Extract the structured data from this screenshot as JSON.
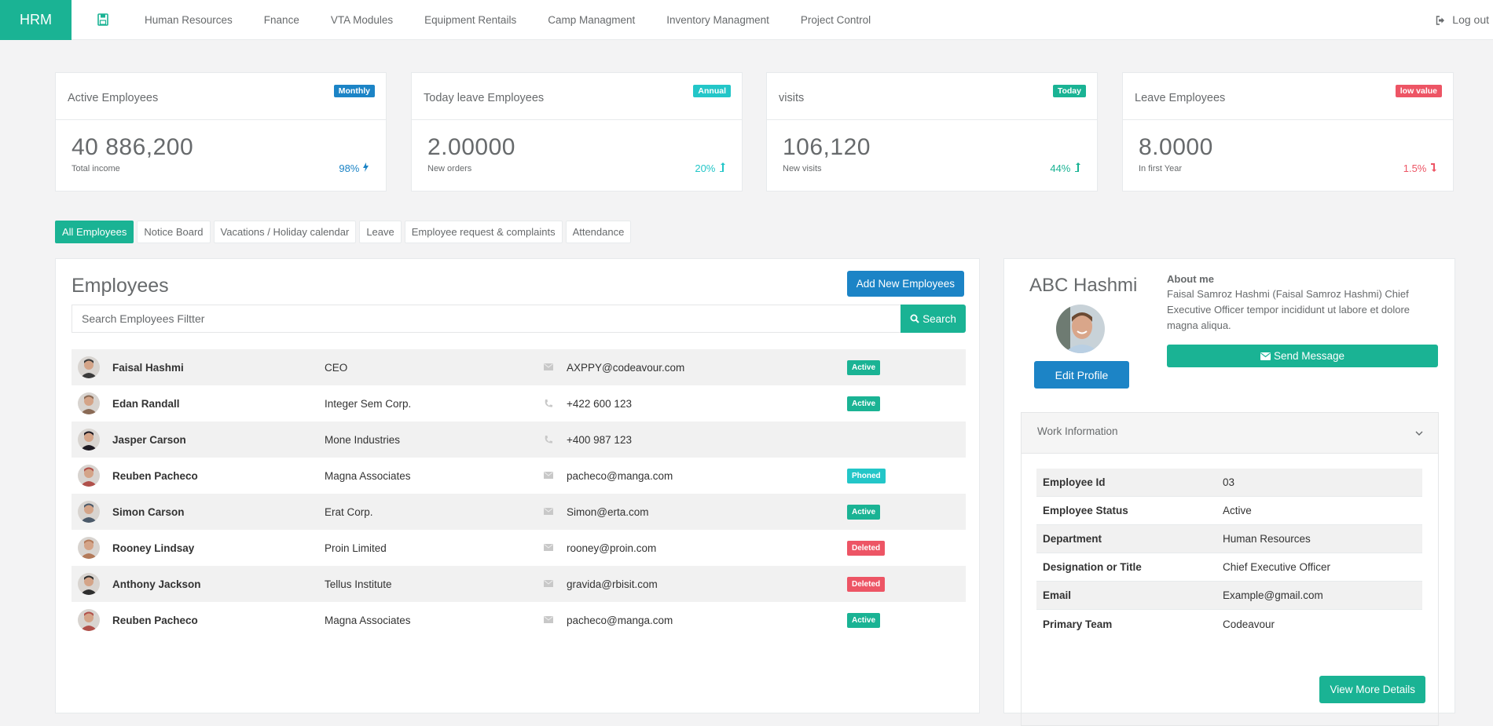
{
  "nav": {
    "brand": "HRM",
    "save_icon": "floppy-disk-icon",
    "links": [
      "Human Resources",
      "Fnance",
      "VTA Modules",
      "Equipment Rentails",
      "Camp Managment",
      "Inventory Managment",
      "Project Control"
    ],
    "logout_label": "Log out"
  },
  "stats": [
    {
      "title": "Active Employees",
      "badge": "Monthly",
      "badge_color": "#1c84c6",
      "value": "40 886,200",
      "sub": "Total income",
      "pct": "98%",
      "pct_icon": "bolt-icon",
      "pct_color": "#1c84c6"
    },
    {
      "title": "Today leave Employees",
      "badge": "Annual",
      "badge_color": "#23c6c8",
      "value": "2.00000",
      "sub": "New orders",
      "pct": "20%",
      "pct_icon": "level-up-icon",
      "pct_color": "#23c6c8"
    },
    {
      "title": "visits",
      "badge": "Today",
      "badge_color": "#1ab394",
      "value": "106,120",
      "sub": "New visits",
      "pct": "44%",
      "pct_icon": "level-up-icon",
      "pct_color": "#1ab394"
    },
    {
      "title": "Leave Employees",
      "badge": "low value",
      "badge_color": "#ed5565",
      "value": "8.0000",
      "sub": "In first Year",
      "pct": "1.5%",
      "pct_icon": "level-down-icon",
      "pct_color": "#ed5565"
    }
  ],
  "tabs": [
    {
      "label": "All Employees",
      "active": true
    },
    {
      "label": "Notice Board",
      "active": false
    },
    {
      "label": "Vacations / Holiday calendar",
      "active": false
    },
    {
      "label": "Leave",
      "active": false
    },
    {
      "label": "Employee request & complaints",
      "active": false
    },
    {
      "label": "Attendance",
      "active": false
    }
  ],
  "employees": {
    "title": "Employees",
    "add_label": "Add New Employees",
    "search_placeholder": "Search Employees Filtter",
    "search_label": "Search",
    "rows": [
      {
        "name": "Faisal Hashmi",
        "company": "CEO",
        "contact_type": "email",
        "contact": "AXPPY@codeavour.com",
        "status": "Active",
        "status_color": "#1ab394",
        "avatar_color": "#3a3a3a"
      },
      {
        "name": "Edan Randall",
        "company": "Integer Sem Corp.",
        "contact_type": "phone",
        "contact": "+422 600 123",
        "status": "Active",
        "status_color": "#1ab394",
        "avatar_color": "#8a6a55"
      },
      {
        "name": "Jasper Carson",
        "company": "Mone Industries",
        "contact_type": "phone",
        "contact": "+400 987 123",
        "status": "",
        "status_color": "",
        "avatar_color": "#1d1a22"
      },
      {
        "name": "Reuben Pacheco",
        "company": "Magna Associates",
        "contact_type": "email",
        "contact": "pacheco@manga.com",
        "status": "Phoned",
        "status_color": "#23c6c8",
        "avatar_color": "#b0504a"
      },
      {
        "name": "Simon Carson",
        "company": "Erat Corp.",
        "contact_type": "email",
        "contact": "Simon@erta.com",
        "status": "Active",
        "status_color": "#1ab394",
        "avatar_color": "#4b5a6a"
      },
      {
        "name": "Rooney Lindsay",
        "company": "Proin Limited",
        "contact_type": "email",
        "contact": "rooney@proin.com",
        "status": "Deleted",
        "status_color": "#ed5565",
        "avatar_color": "#b37a5a"
      },
      {
        "name": "Anthony Jackson",
        "company": "Tellus Institute",
        "contact_type": "email",
        "contact": "gravida@rbisit.com",
        "status": "Deleted",
        "status_color": "#ed5565",
        "avatar_color": "#2e2e2e"
      },
      {
        "name": "Reuben Pacheco",
        "company": "Magna Associates",
        "contact_type": "email",
        "contact": "pacheco@manga.com",
        "status": "Active",
        "status_color": "#1ab394",
        "avatar_color": "#b0504a"
      }
    ]
  },
  "profile": {
    "name": "ABC Hashmi",
    "edit_label": "Edit Profile",
    "about_heading": "About me",
    "about_text": "Faisal Samroz Hashmi (Faisal Samroz Hashmi) Chief Executive Officer tempor incididunt ut labore et dolore magna aliqua.",
    "send_label": "Send Message",
    "work_title": "Work Information",
    "info": [
      {
        "key": "Employee Id",
        "value": "03"
      },
      {
        "key": "Employee Status",
        "value": "Active"
      },
      {
        "key": "Department",
        "value": "Human Resources"
      },
      {
        "key": "Designation or Title",
        "value": "Chief Executive Officer"
      },
      {
        "key": "Email",
        "value": "Example@gmail.com"
      },
      {
        "key": "Primary Team",
        "value": "Codeavour"
      }
    ],
    "view_more_label": "View More Details"
  }
}
